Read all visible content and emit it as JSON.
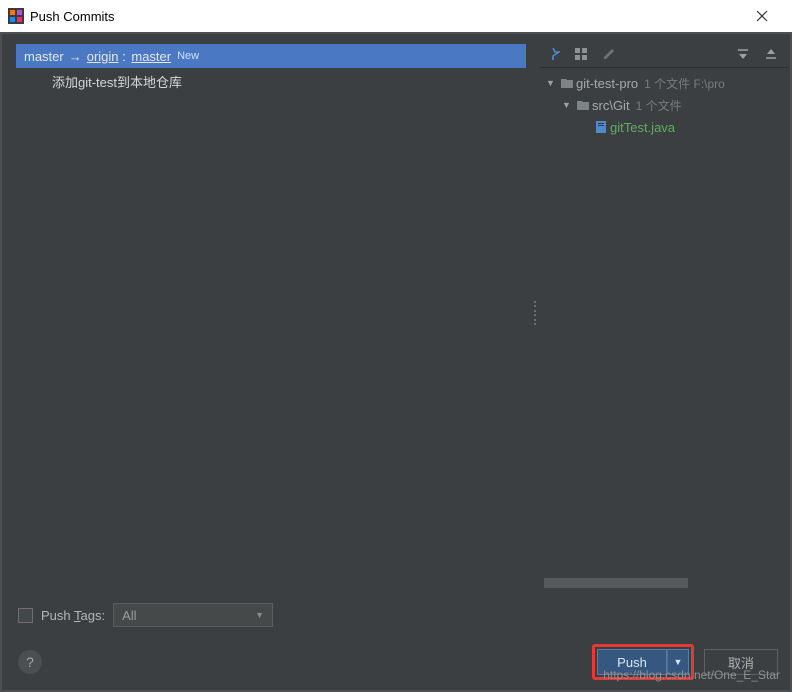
{
  "window": {
    "title": "Push Commits"
  },
  "branch": {
    "local": "master",
    "remote": "origin",
    "destination": "master",
    "new_badge": "New"
  },
  "commits": [
    {
      "message": "添加git-test到本地仓库"
    }
  ],
  "tree": {
    "root": {
      "name": "git-test-pro",
      "meta": "1 个文件  F:\\pro"
    },
    "sub": {
      "name": "src\\Git",
      "meta": "1 个文件"
    },
    "file": {
      "name": "gitTest.java"
    }
  },
  "footer": {
    "push_tags_label_pre": "Push ",
    "push_tags_mnemonic": "T",
    "push_tags_label_post": "ags:",
    "select_value": "All",
    "push_button": "Push",
    "cancel_button": "取消"
  },
  "icons": {
    "pin": "pin",
    "group": "group",
    "edit": "edit",
    "expand": "expand",
    "collapse": "collapse"
  },
  "watermark": "https://blog.csdn.net/One_E_Star"
}
